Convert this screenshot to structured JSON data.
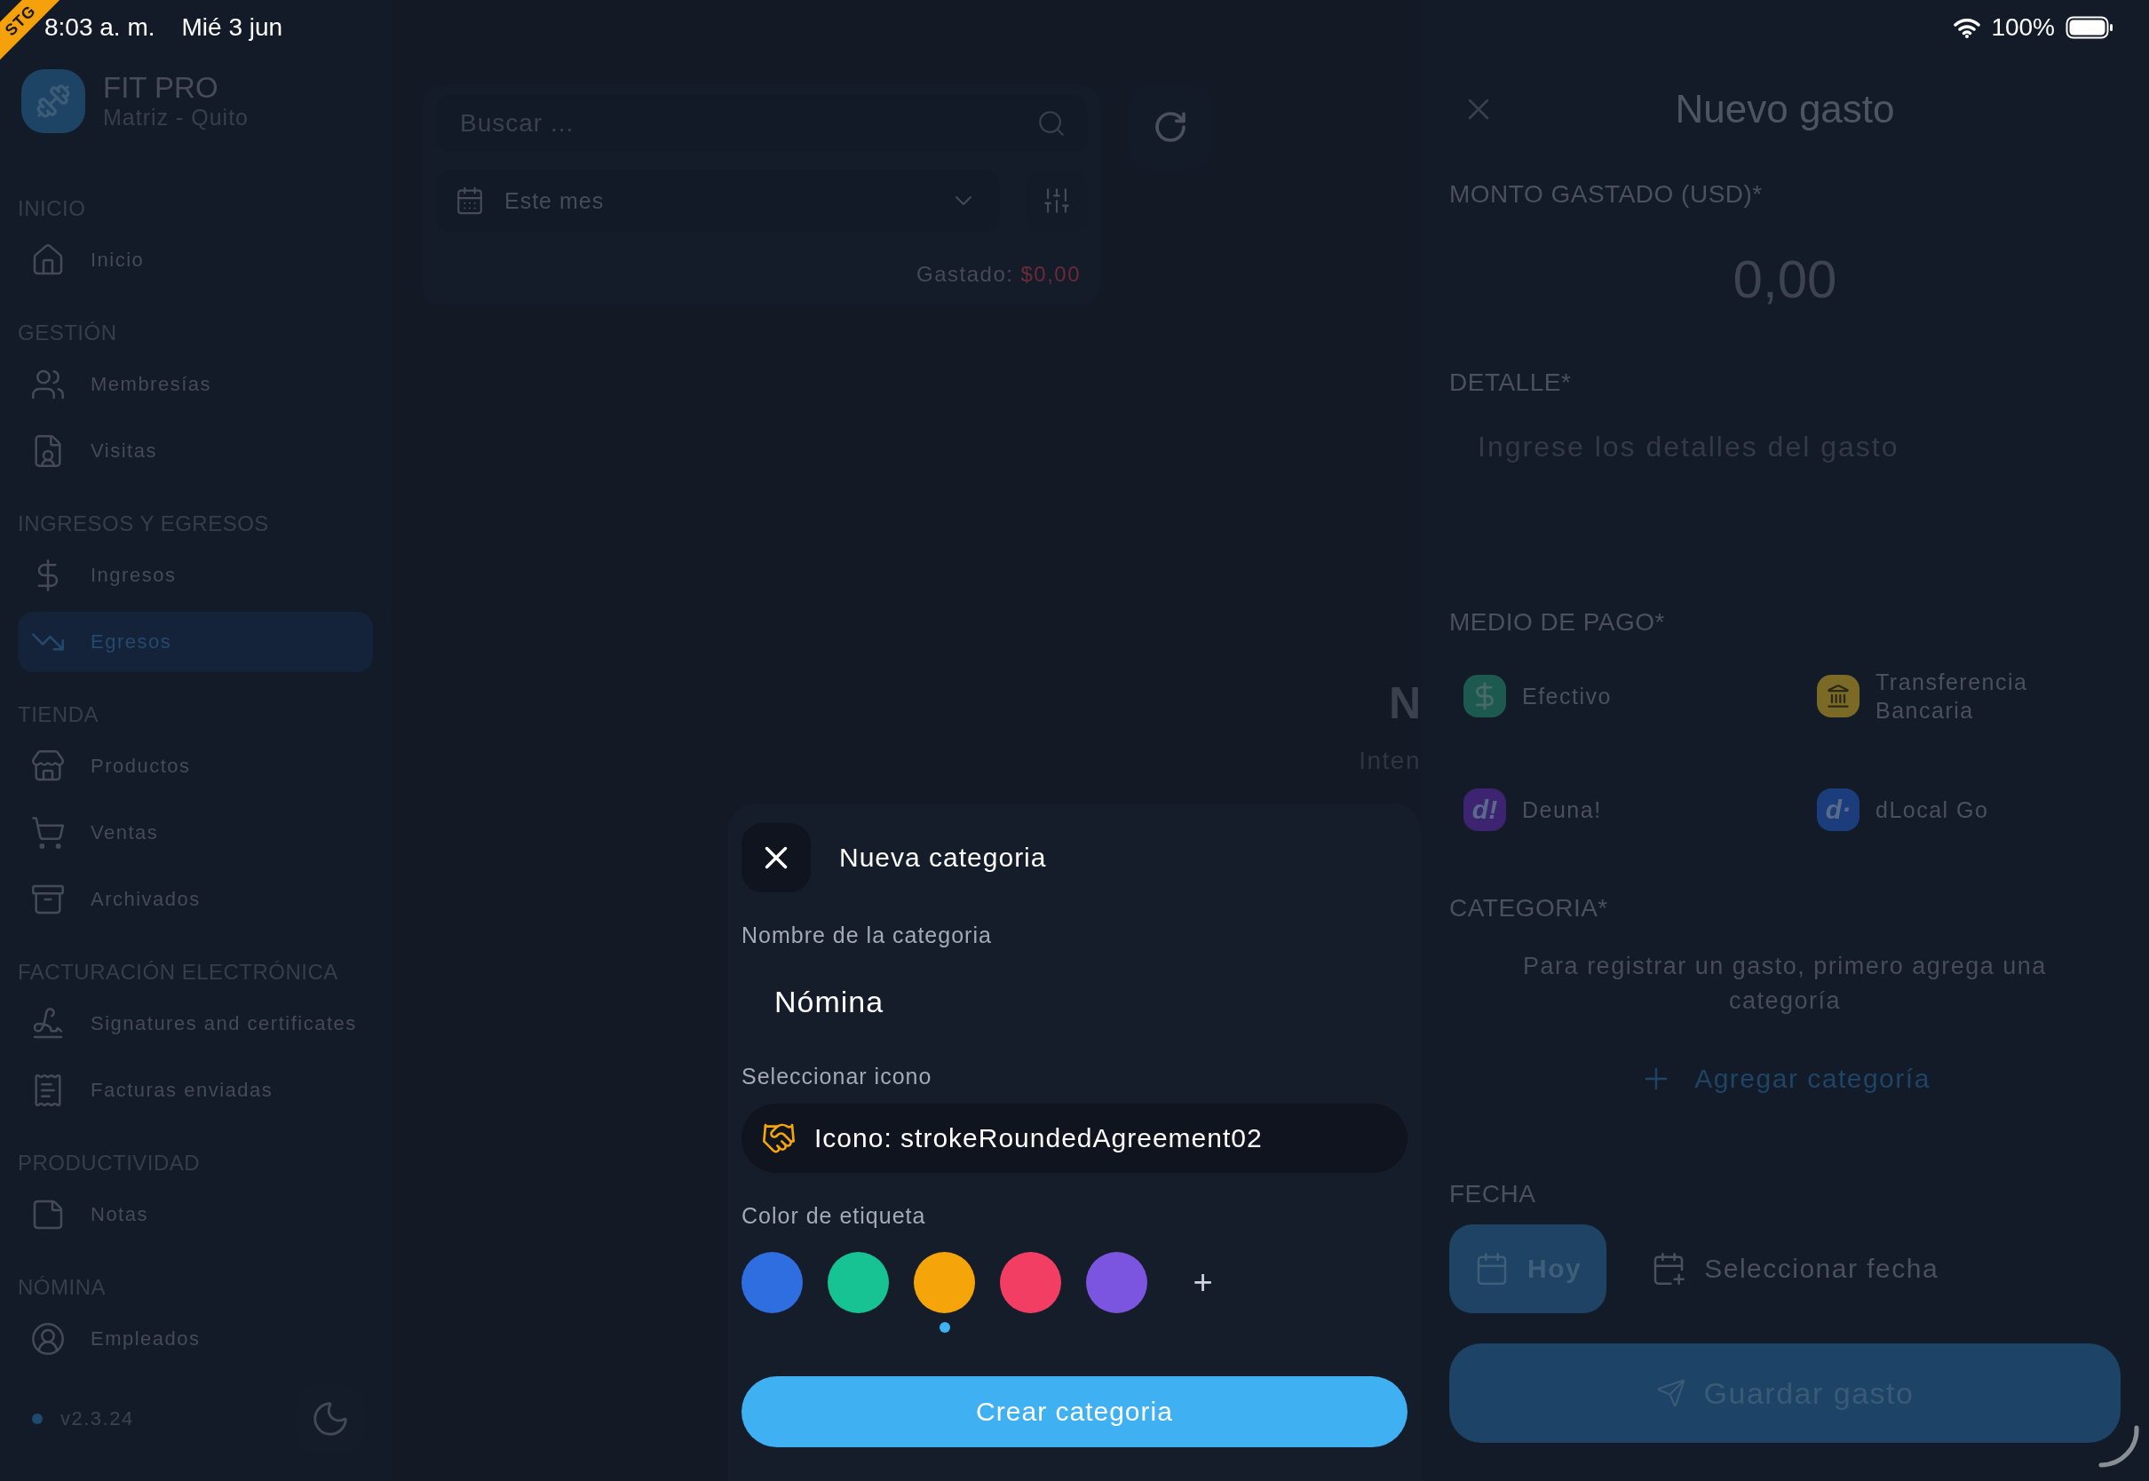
{
  "status_bar": {
    "time": "8:03 a. m.",
    "date": "Mié 3 jun",
    "battery": "100%"
  },
  "ribbon": {
    "label": "STG"
  },
  "brand": {
    "name": "FIT PRO",
    "branch": "Matriz - Quito"
  },
  "sidebar": {
    "sections": [
      {
        "title": "INICIO",
        "items": [
          {
            "label": "Inicio",
            "selected": false
          }
        ]
      },
      {
        "title": "GESTIÓN",
        "items": [
          {
            "label": "Membresías",
            "selected": false
          },
          {
            "label": "Visitas",
            "selected": false
          }
        ]
      },
      {
        "title": "INGRESOS Y EGRESOS",
        "items": [
          {
            "label": "Ingresos",
            "selected": false
          },
          {
            "label": "Egresos",
            "selected": true
          }
        ]
      },
      {
        "title": "TIENDA",
        "items": [
          {
            "label": "Productos",
            "selected": false
          },
          {
            "label": "Ventas",
            "selected": false
          },
          {
            "label": "Archivados",
            "selected": false
          }
        ]
      },
      {
        "title": "FACTURACIÓN ELECTRÓNICA",
        "items": [
          {
            "label": "Signatures and certificates",
            "selected": false
          },
          {
            "label": "Facturas enviadas",
            "selected": false
          }
        ]
      },
      {
        "title": "PRODUCTIVIDAD",
        "items": [
          {
            "label": "Notas",
            "selected": false
          }
        ]
      },
      {
        "title": "NÓMINA",
        "items": [
          {
            "label": "Empleados",
            "selected": false
          }
        ]
      }
    ],
    "version": "v2.3.24"
  },
  "toolbar": {
    "search": {
      "placeholder": "Buscar ..."
    },
    "period": {
      "value": "Este mes"
    },
    "spent": {
      "label": "Gastado:",
      "amount": "$0,00"
    }
  },
  "empty_state": {
    "title": "N",
    "subtitle": "Inten"
  },
  "expense_panel": {
    "title": "Nuevo gasto",
    "amount": {
      "label": "MONTO GASTADO (USD)*",
      "placeholder": "0,00"
    },
    "detail": {
      "label": "DETALLE*",
      "placeholder": "Ingrese los detalles del gasto"
    },
    "payment": {
      "label": "MEDIO DE PAGO*",
      "options": [
        {
          "label": "Efectivo",
          "kind": "cash",
          "color": "#1c5a4f"
        },
        {
          "label": "Transferencia Bancaria",
          "kind": "bank",
          "color": "#7a6a26"
        },
        {
          "label": "Deuna!",
          "kind": "logo",
          "logo_text": "d!",
          "color": "#3d2470"
        },
        {
          "label": "dLocal Go",
          "kind": "logo",
          "logo_text": "d·",
          "color": "#1c3d7c"
        }
      ]
    },
    "category": {
      "label": "CATEGORIA*",
      "message": "Para registrar un gasto, primero agrega una categoría",
      "add_button": "Agregar categoría"
    },
    "date": {
      "label": "FECHA",
      "options": [
        {
          "label": "Hoy",
          "selected": true
        },
        {
          "label": "Seleccionar fecha",
          "selected": false
        }
      ]
    },
    "save_button": "Guardar gasto"
  },
  "category_modal": {
    "title": "Nueva categoria",
    "name": {
      "label": "Nombre de la categoria",
      "value": "Nómina"
    },
    "icon": {
      "label": "Seleccionar icono",
      "value": "Icono: strokeRoundedAgreement02"
    },
    "color": {
      "label": "Color de etiqueta",
      "add": "+",
      "options": [
        {
          "color": "#2f6ee0",
          "selected": false
        },
        {
          "color": "#17c392",
          "selected": false
        },
        {
          "color": "#f5a50a",
          "selected": true
        },
        {
          "color": "#f23e63",
          "selected": false
        },
        {
          "color": "#7b55e0",
          "selected": false
        }
      ]
    },
    "create_button": "Crear categoria"
  }
}
